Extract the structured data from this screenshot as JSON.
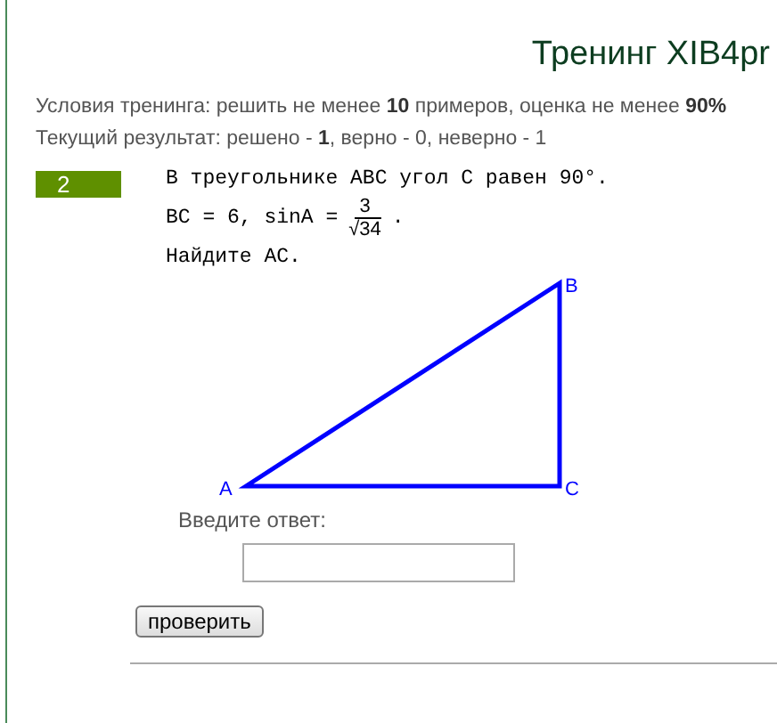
{
  "title": "Тренинг XIB4pr",
  "conditions": "Условия тренинга: решить не менее **10** примеров, оценка не менее **90%**",
  "result": "Текущий результат: решено - **1**, верно - 0, неверно - 1",
  "task": {
    "number": "2",
    "line_1": "В треугольнике ABC угол C равен 90°.",
    "line_2_prefix": "BC = 6, sinA =",
    "numerator": "3",
    "radical": "√",
    "radicand": "34",
    "line_2_suffix": ".",
    "line_3": "Найдите AC.",
    "vertices": [
      {
        "label": "A"
      },
      {
        "label": "B"
      },
      {
        "label": "C"
      }
    ]
  },
  "answer": {
    "label": "Введите ответ:"
  },
  "check_button": "проверить"
}
